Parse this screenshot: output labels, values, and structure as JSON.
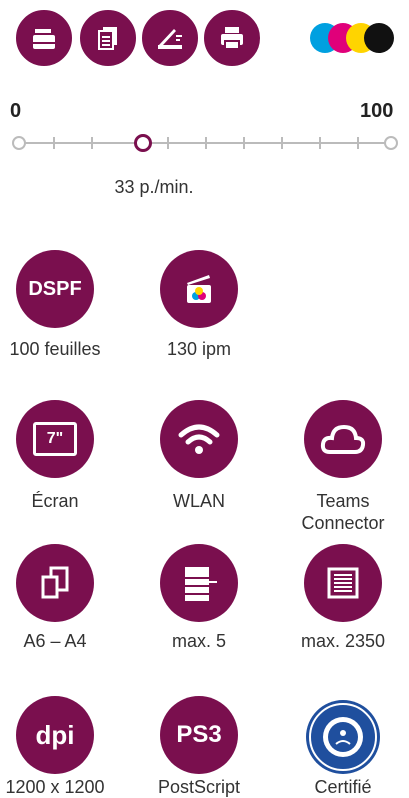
{
  "top_icons": [
    {
      "name": "copy-icon"
    },
    {
      "name": "document-stack-icon"
    },
    {
      "name": "scanner-icon"
    },
    {
      "name": "printer-icon"
    }
  ],
  "ink": {
    "colors": [
      "#00a0e0",
      "#e0007a",
      "#ffd400",
      "#111111"
    ]
  },
  "scale": {
    "min": "0",
    "max": "100",
    "value": 33,
    "speed_label": "33 p./min."
  },
  "features": [
    {
      "icon_text": "DSPF",
      "label": "100 feuilles"
    },
    {
      "icon_text": "",
      "label": "130 ipm"
    },
    {
      "icon_text": "7\"",
      "label": "Écran"
    },
    {
      "icon_text": "",
      "label": "WLAN"
    },
    {
      "icon_text": "",
      "label": "Teams\nConnector"
    },
    {
      "icon_text": "",
      "label": "A6 – A4"
    },
    {
      "icon_text": "",
      "label": "max. 5"
    },
    {
      "icon_text": "",
      "label": "max. 2350"
    },
    {
      "icon_text": "dpi",
      "label": "1200 x 1200"
    },
    {
      "icon_text": "PS3",
      "label": "PostScript"
    },
    {
      "icon_text": "BLAUER ENGEL",
      "label": "Certifié"
    }
  ]
}
